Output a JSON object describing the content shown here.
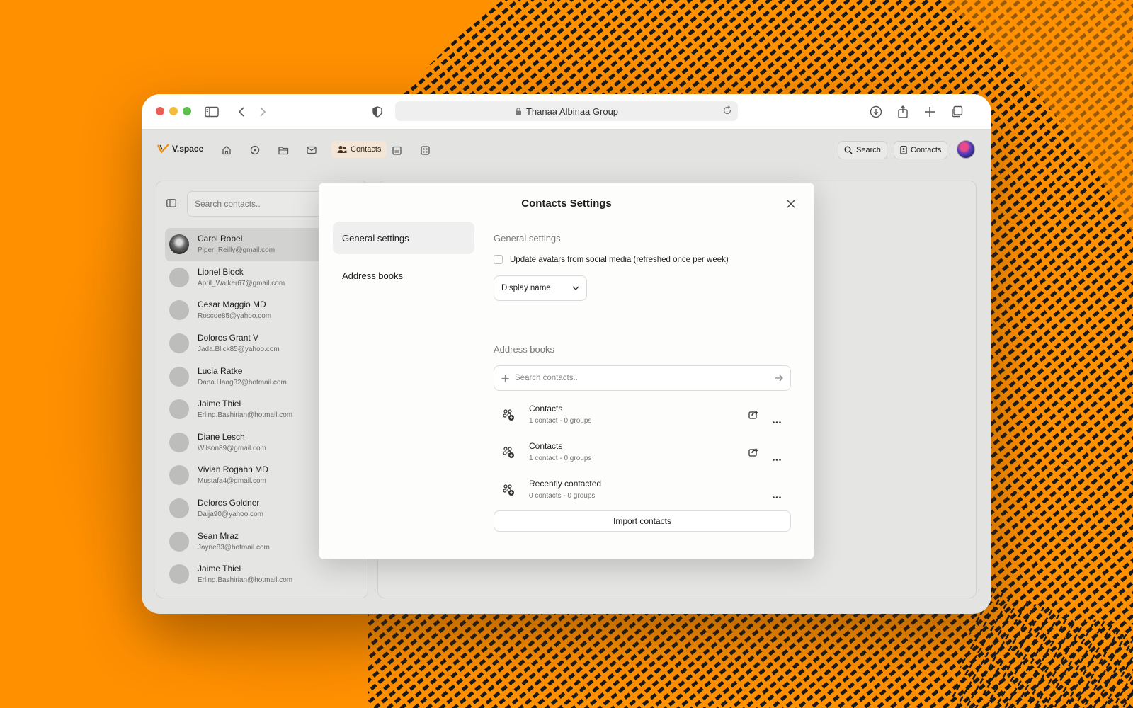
{
  "colors": {
    "background": "#FF9000",
    "pattern": "#1A1A1A",
    "accent_nav": "#F3E6D6"
  },
  "browser": {
    "url_title": "Thanaa Albinaa Group"
  },
  "app": {
    "brand": "V.space",
    "nav_active_label": "Contacts",
    "search_label": "Search",
    "contacts_button_label": "Contacts"
  },
  "contacts_panel": {
    "search_placeholder": "Search contacts..",
    "contacts": [
      {
        "name": "Carol Robel",
        "email": "Piper_Reilly@gmail.com"
      },
      {
        "name": "Lionel Block",
        "email": "April_Walker67@gmail.com"
      },
      {
        "name": "Cesar Maggio MD",
        "email": "Roscoe85@yahoo.com"
      },
      {
        "name": "Dolores Grant V",
        "email": "Jada.Blick85@yahoo.com"
      },
      {
        "name": "Lucia Ratke",
        "email": "Dana.Haag32@hotmail.com"
      },
      {
        "name": "Jaime Thiel",
        "email": "Erling.Bashirian@hotmail.com"
      },
      {
        "name": "Diane Lesch",
        "email": "Wilson89@gmail.com"
      },
      {
        "name": "Vivian Rogahn MD",
        "email": "Mustafa4@gmail.com"
      },
      {
        "name": "Delores Goldner",
        "email": "Daija90@yahoo.com"
      },
      {
        "name": "Sean Mraz",
        "email": "Jayne83@hotmail.com"
      },
      {
        "name": "Jaime Thiel",
        "email": "Erling.Bashirian@hotmail.com"
      }
    ]
  },
  "modal": {
    "title": "Contacts Settings",
    "nav": [
      "General settings",
      "Address books"
    ],
    "general": {
      "title": "General settings",
      "avatar_option": "Update avatars from social media (refreshed once per week)",
      "display_select": "Display name"
    },
    "address_books": {
      "title": "Address books",
      "search_placeholder": "Search contacts..",
      "books": [
        {
          "name": "Contacts",
          "meta": "1 contact - 0 groups"
        },
        {
          "name": "Contacts",
          "meta": "1 contact - 0 groups"
        },
        {
          "name": "Recently contacted",
          "meta": "0 contacts - 0 groups"
        }
      ],
      "import_label": "Import contacts"
    }
  }
}
